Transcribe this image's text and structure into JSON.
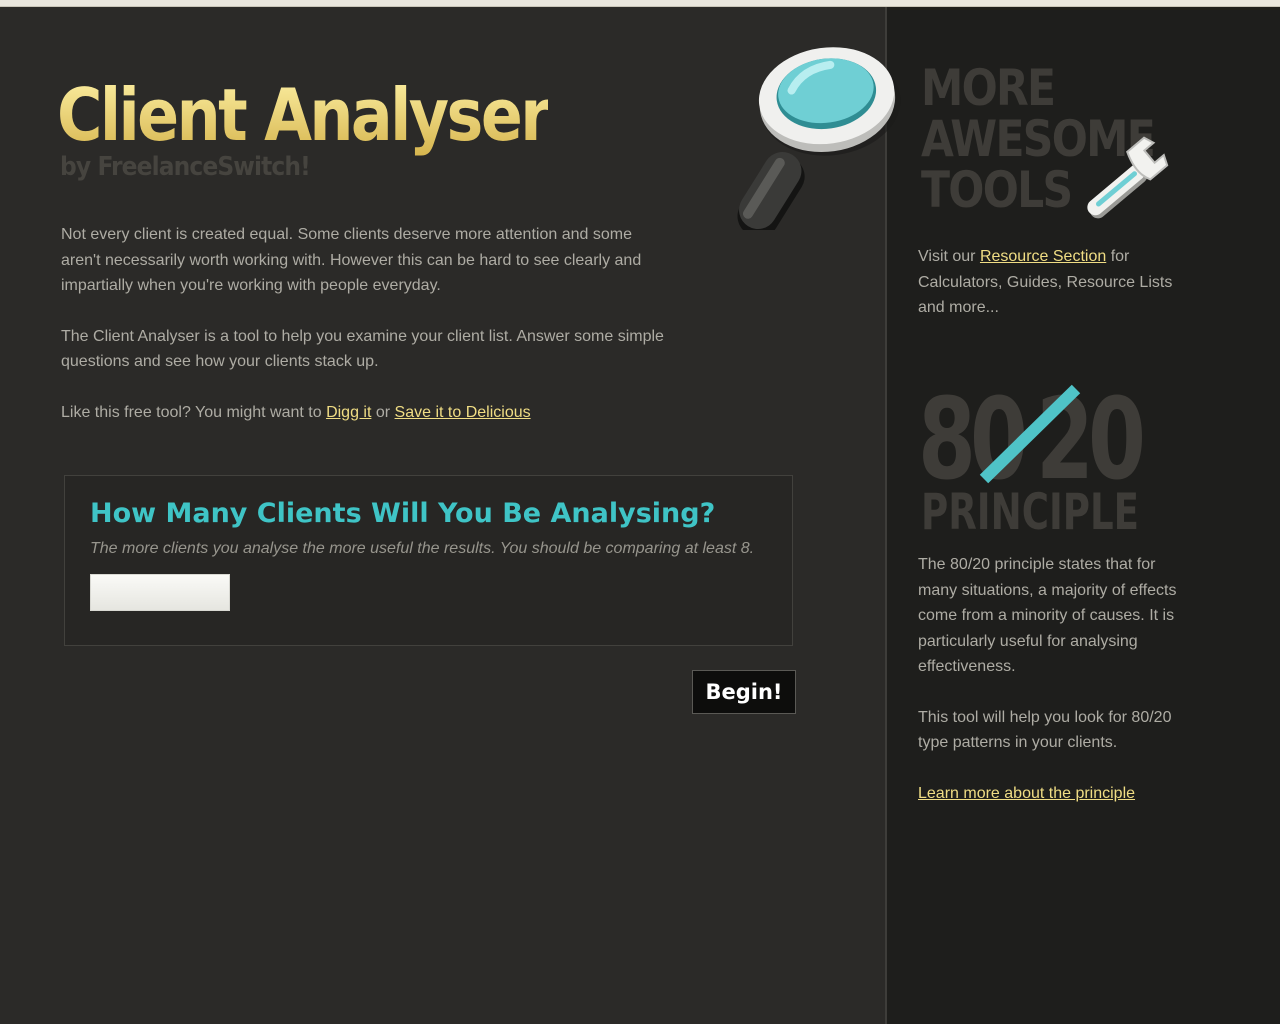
{
  "header": {
    "title": "Client Analyser",
    "subtitle": "by FreelanceSwitch!"
  },
  "intro": {
    "p1": "Not every client is created equal. Some clients deserve more attention and some aren't necessarily worth working with. However this can be hard to see clearly and impartially when you're working with people everyday.",
    "p2": "The Client Analyser is a tool to help you examine your client list. Answer some simple questions and see how your clients stack up.",
    "p3_prefix": "Like this free tool? You might want to ",
    "digg_link": "Digg it",
    "p3_or": " or ",
    "delicious_link": "Save it to Delicious"
  },
  "question": {
    "title": "How Many Clients Will You Be Analysing?",
    "hint": "The more clients you analyse the more useful the results. You should be comparing at least 8.",
    "input_value": ""
  },
  "actions": {
    "begin_label": "Begin!"
  },
  "sidebar": {
    "more_tools_line1": "MORE",
    "more_tools_line2": "AWESOME",
    "more_tools_line3": "TOOLS",
    "resource_prefix": "Visit our ",
    "resource_link": "Resource Section",
    "resource_suffix": " for Calculators, Guides, Resource Lists and more...",
    "principle_number_left": "80",
    "principle_number_right": "20",
    "principle_word": "PRINCIPLE",
    "principle_p1": "The 80/20 principle states that for many situations, a majority of effects come from a minority of causes. It is particularly useful for analysing effectiveness.",
    "principle_p2": "This tool will help you look for 80/20 type patterns in your clients.",
    "learn_link": "Learn more about the principle"
  },
  "colors": {
    "background": "#2b2a28",
    "sidebar_background": "#1e1e1c",
    "accent_teal": "#3fc4c6",
    "link_yellow": "#f0dd84",
    "body_text": "#aeaca4"
  },
  "icons": [
    "magnifier-icon",
    "wrench-icon"
  ]
}
